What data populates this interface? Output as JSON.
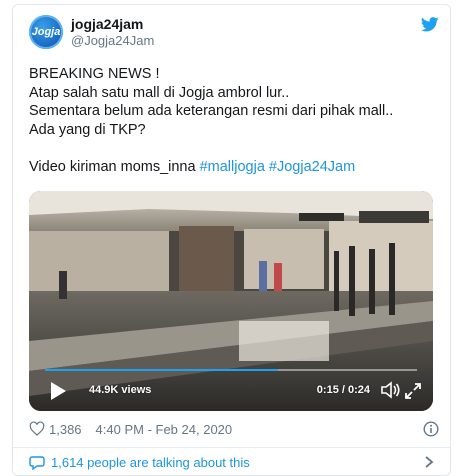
{
  "tweet": {
    "avatar_text": "Jogja",
    "display_name": "jogja24jam",
    "handle": "@Jogja24Jam",
    "lines": [
      "BREAKING NEWS !",
      "Atap salah satu mall di Jogja ambrol lur..",
      "Sementara belum ada keterangan resmi dari pihak mall..",
      "Ada yang di TKP?"
    ],
    "credit_prefix": "Video kiriman moms_inna",
    "hashtags": [
      "#malljogja",
      "#Jogja24Jam"
    ]
  },
  "video": {
    "views": "44.9K views",
    "time": "0:15 / 0:24",
    "progress": 0.625
  },
  "footer": {
    "likes": "1,386",
    "timestamp": "4:40 PM - Feb 24, 2020",
    "talking": "1,614 people are talking about this"
  },
  "colors": {
    "accent": "#1da1f2",
    "link": "#1b95e0",
    "muted": "#657786"
  }
}
